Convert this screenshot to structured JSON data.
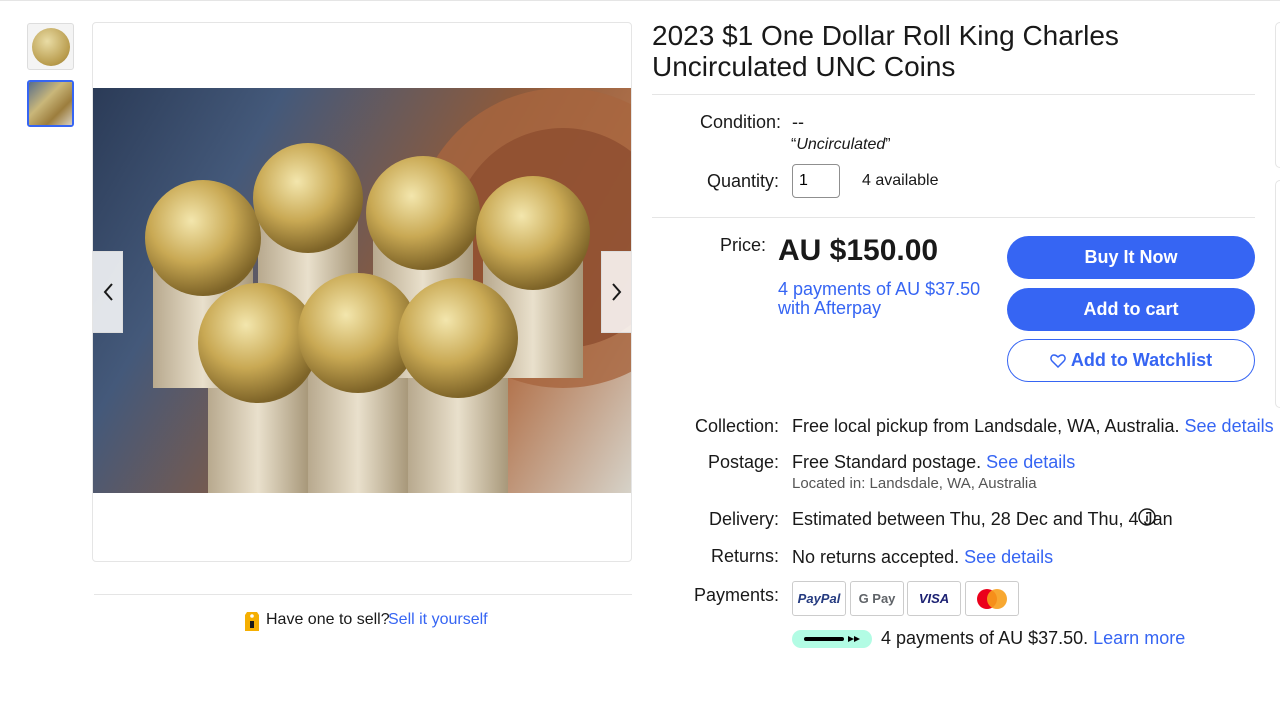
{
  "listing": {
    "title": "2023 $1 One Dollar Roll King Charles Uncirculated UNC Coins"
  },
  "thumbnails": [
    {
      "name": "coin-front"
    },
    {
      "name": "coin-rolls"
    }
  ],
  "seller_prompt": {
    "text": "Have one to sell?",
    "link": "Sell it yourself"
  },
  "condition": {
    "label": "Condition:",
    "dashes": "--",
    "quote_open": "“",
    "value": "Uncirculated",
    "quote_close": "”"
  },
  "quantity": {
    "label": "Quantity:",
    "value": "1",
    "available": "4 available"
  },
  "price": {
    "label": "Price:",
    "value": "AU $150.00",
    "afterpay": "4 payments of AU $37.50 with Afterpay"
  },
  "buttons": {
    "buy_now": "Buy It Now",
    "add_to_cart": "Add to cart",
    "add_to_watchlist": "Add to Watchlist"
  },
  "collection": {
    "label": "Collection:",
    "text": "Free local pickup from Landsdale, WA, Australia.",
    "link": "See details"
  },
  "postage": {
    "label": "Postage:",
    "free": "Free",
    "method": "Standard postage.",
    "link": "See details",
    "location": "Located in: Landsdale, WA, Australia"
  },
  "delivery": {
    "label": "Delivery:",
    "prefix": "Estimated between",
    "range": "Thu, 28 Dec and Thu, 4 Jan"
  },
  "returns": {
    "label": "Returns:",
    "text": "No returns accepted.",
    "link": "See details"
  },
  "payments": {
    "label": "Payments:",
    "methods": [
      "PayPal",
      "G Pay",
      "VISA",
      "Mastercard"
    ],
    "afterpay_text": "4 payments of AU $37.50.",
    "afterpay_link": "Learn more"
  },
  "colors": {
    "accent": "#3665f3",
    "text": "#191919",
    "divider": "#e5e5e5"
  }
}
